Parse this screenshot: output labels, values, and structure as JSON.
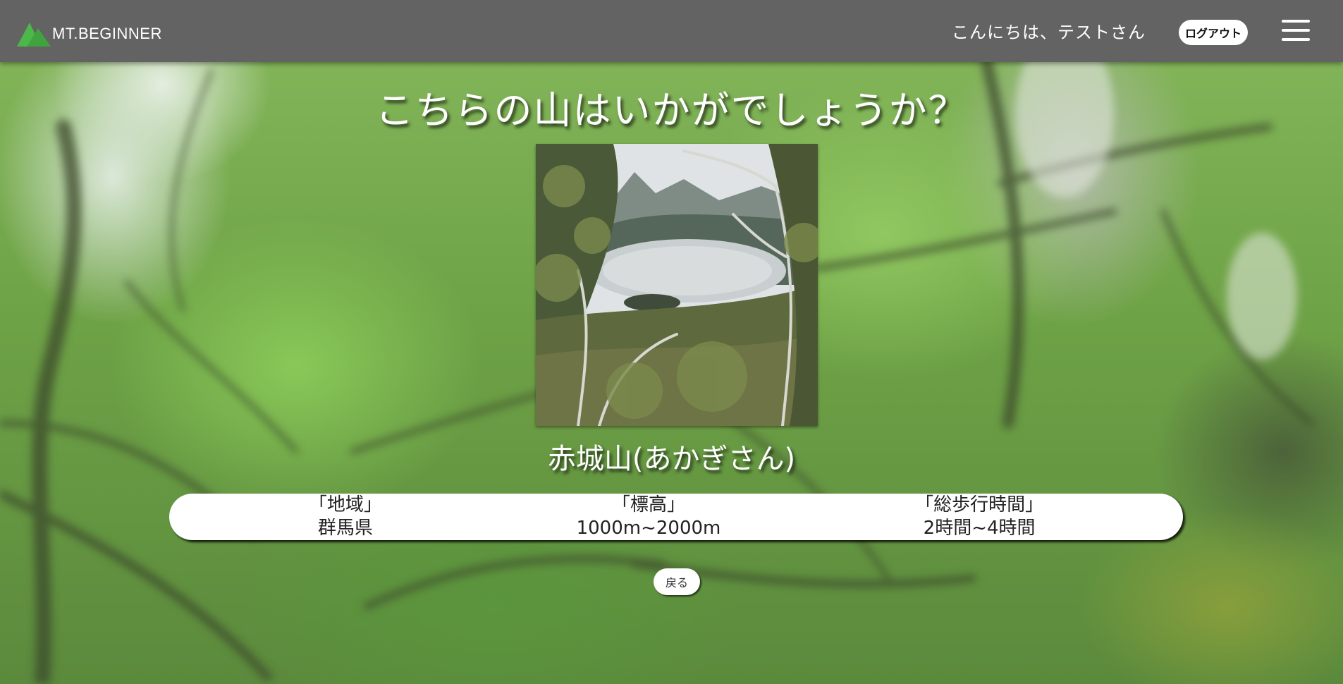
{
  "header": {
    "logo_text": "MT.BEGINNER",
    "greeting": "こんにちは、テストさん",
    "logout_label": "ログアウト",
    "menu_icon": "hamburger-menu-icon"
  },
  "main": {
    "title": "こちらの山はいかがでしょうか？",
    "mountain_name": "赤城山(あかぎさん)",
    "info": {
      "region_label": "「地域」",
      "region_value": "群馬県",
      "elevation_label": "「標高」",
      "elevation_value": "1000m~2000m",
      "walk_time_label": "「総歩行時間」",
      "walk_time_value": "2時間~4時間"
    },
    "back_label": "戻る"
  },
  "colors": {
    "header_bg": "#636363",
    "logo_green": "#4cb84a",
    "button_bg": "#ffffff"
  }
}
